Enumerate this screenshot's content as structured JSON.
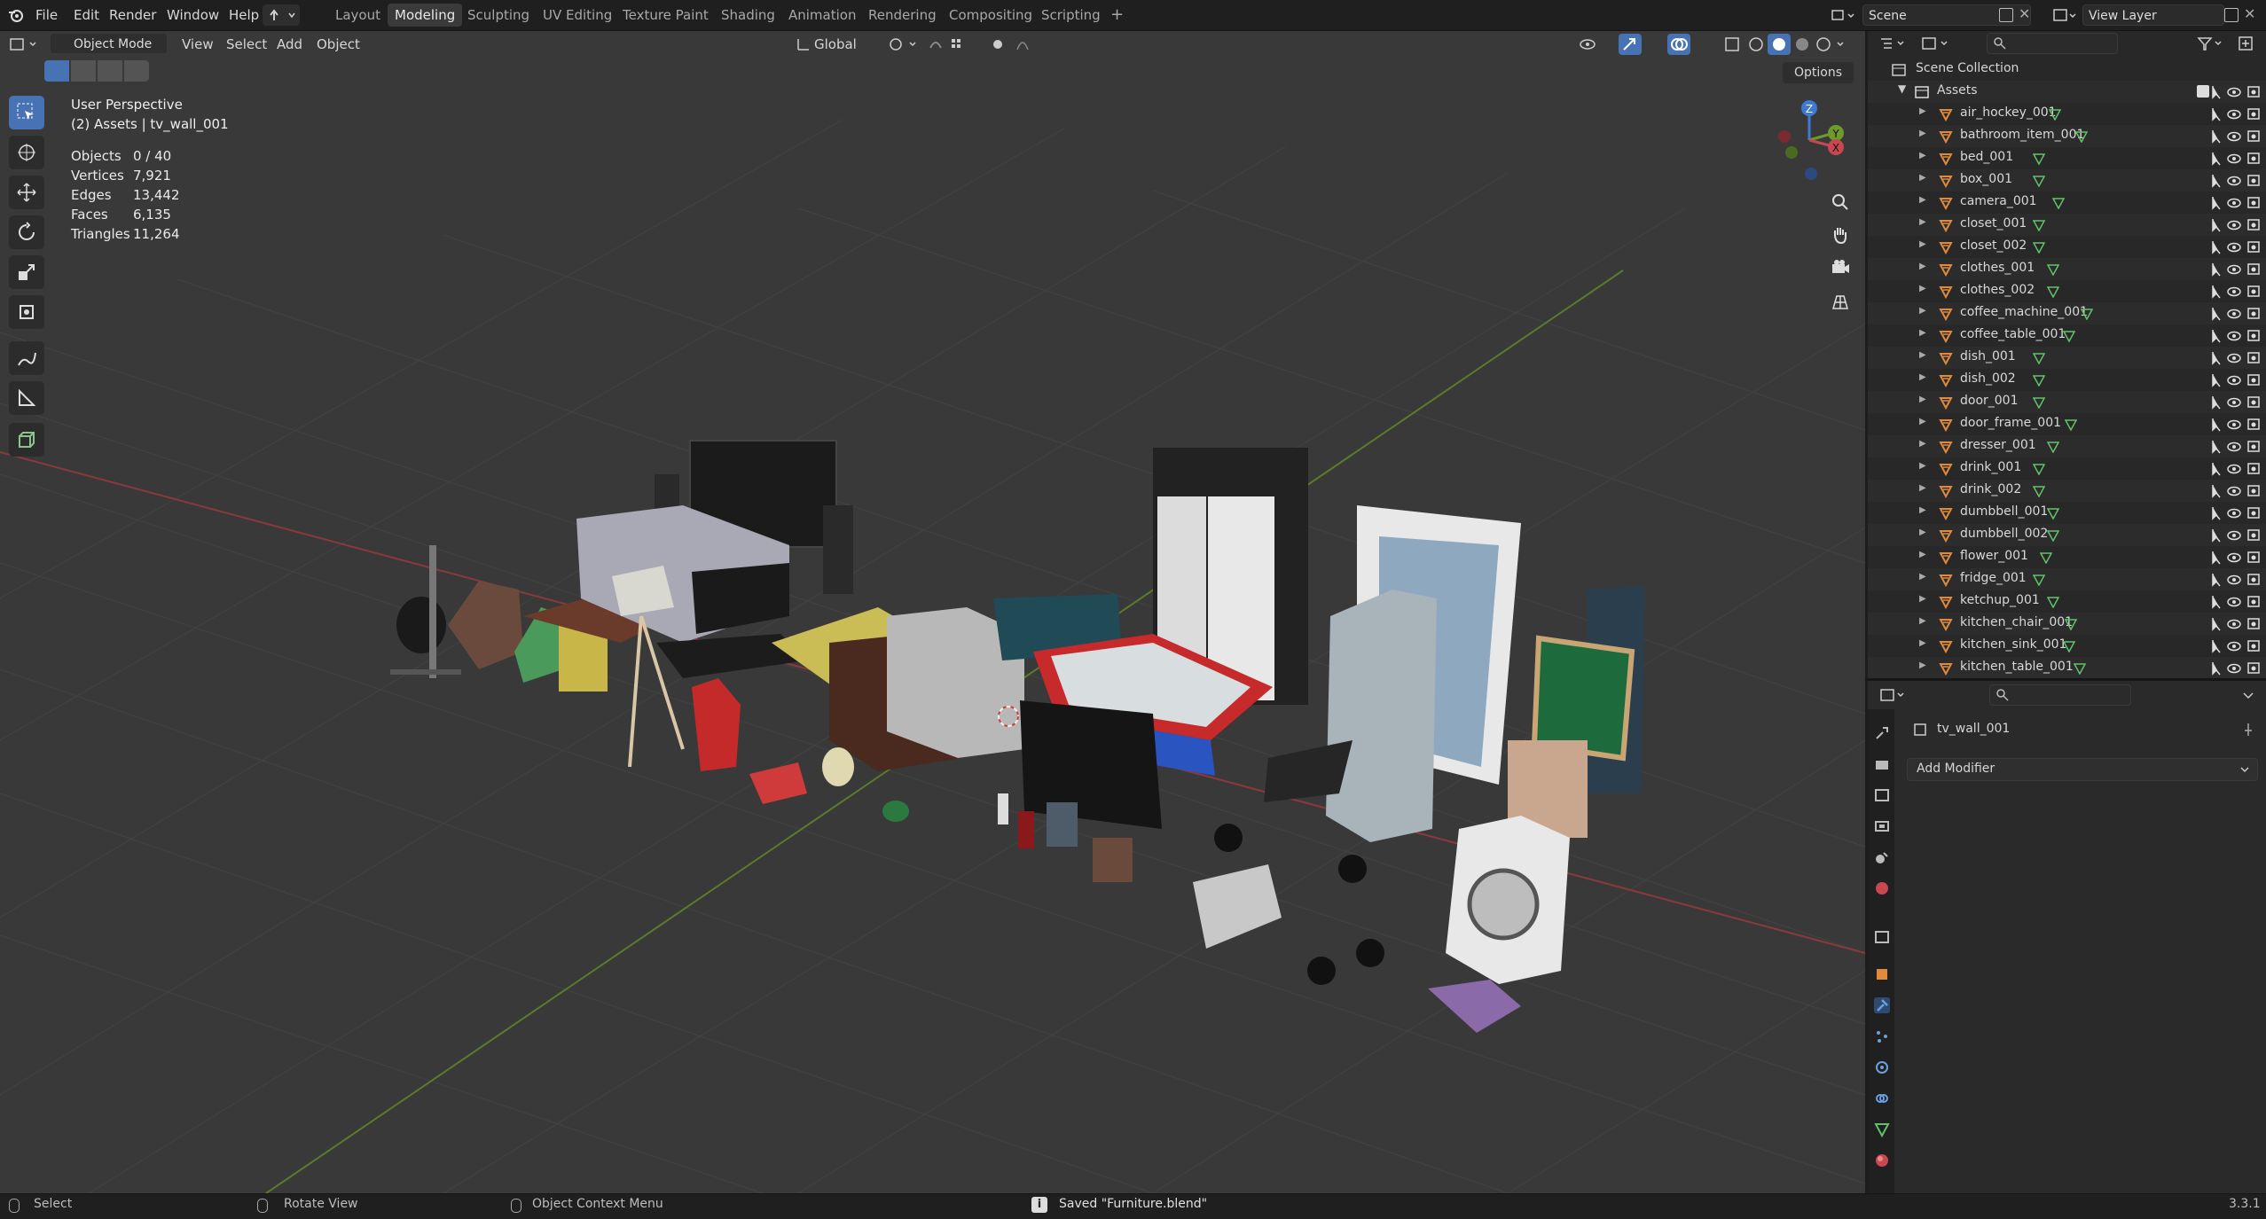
{
  "menubar": {
    "items": [
      "File",
      "Edit",
      "Render",
      "Window",
      "Help"
    ],
    "workspaces": [
      "Layout",
      "Modeling",
      "Sculpting",
      "UV Editing",
      "Texture Paint",
      "Shading",
      "Animation",
      "Rendering",
      "Compositing",
      "Scripting"
    ],
    "active_workspace": "Modeling",
    "add_workspace": "+",
    "scene_name": "Scene",
    "view_layer": "View Layer"
  },
  "viewport_header": {
    "mode": "Object Mode",
    "menus": [
      "View",
      "Select",
      "Add",
      "Object"
    ],
    "transform_orientation": "Global",
    "options": "Options"
  },
  "overlay": {
    "perspective": "User Perspective",
    "collection_info": "(2) Assets | tv_wall_001",
    "stats": [
      {
        "label": "Objects",
        "value": "0 / 40"
      },
      {
        "label": "Vertices",
        "value": "7,921"
      },
      {
        "label": "Edges",
        "value": "13,442"
      },
      {
        "label": "Faces",
        "value": "6,135"
      },
      {
        "label": "Triangles",
        "value": "11,264"
      }
    ]
  },
  "gizmo": {
    "x": "X",
    "y": "Y",
    "z": "Z"
  },
  "outliner": {
    "root": "Scene Collection",
    "collection": "Assets",
    "items": [
      "air_hockey_001",
      "bathroom_item_001",
      "bed_001",
      "box_001",
      "camera_001",
      "closet_001",
      "closet_002",
      "clothes_001",
      "clothes_002",
      "coffee_machine_001",
      "coffee_table_001",
      "dish_001",
      "dish_002",
      "door_001",
      "door_frame_001",
      "dresser_001",
      "drink_001",
      "drink_002",
      "dumbbell_001",
      "dumbbell_002",
      "flower_001",
      "fridge_001",
      "ketchup_001",
      "kitchen_chair_001",
      "kitchen_sink_001",
      "kitchen_table_001"
    ]
  },
  "properties": {
    "object_name": "tv_wall_001",
    "add_modifier": "Add Modifier"
  },
  "statusbar": {
    "select": "Select",
    "rotate": "Rotate View",
    "context": "Object Context Menu",
    "message": "Saved \"Furniture.blend\"",
    "version": "3.3.1"
  },
  "colors": {
    "accent": "#4772b3",
    "x_axis": "#c8484f",
    "y_axis": "#6e9a2b",
    "z_axis": "#3d7ad6",
    "mesh_icon": "#e08a3c",
    "data_icon": "#62c26a"
  }
}
